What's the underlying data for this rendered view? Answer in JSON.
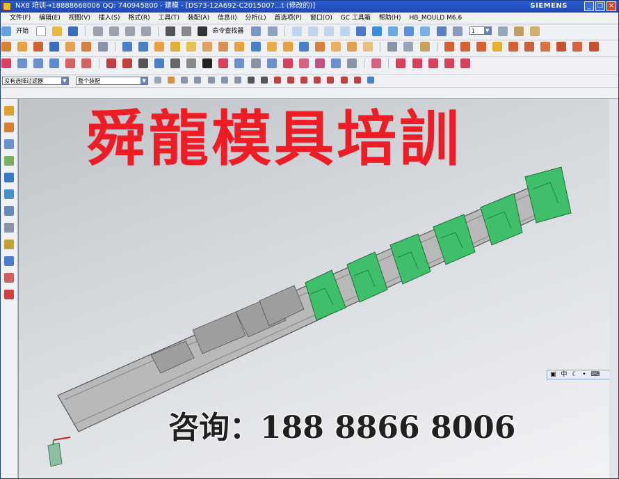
{
  "window": {
    "title": "NX8 培训→18888668006 QQ: 740945800 - 建模 - [DS73-12A692-C2015007...t (修改的)]",
    "brand": "SIEMENS",
    "minimize": "_",
    "restore": "❐",
    "close": "✕"
  },
  "menu": [
    "文件(F)",
    "编辑(E)",
    "视图(V)",
    "插入(S)",
    "格式(R)",
    "工具(T)",
    "装配(A)",
    "信息(I)",
    "分析(L)",
    "首选项(P)",
    "窗口(O)",
    "GC 工具箱",
    "帮助(H)",
    "HB_MOULD M6.6"
  ],
  "toolbar1": {
    "start_label": "开始",
    "command_finder_label": "命令查找器",
    "layer_value": "1"
  },
  "filterbar": {
    "selection_filter": "没有选择过滤器",
    "scope": "整个装配"
  },
  "banner": {
    "text": "舜龍模具培訓"
  },
  "contact": {
    "text": "咨询：188 8866 8006"
  },
  "ime": {
    "label": "中"
  },
  "colors": {
    "banner": "#ee1c24",
    "part_grey": "#b8b8b8",
    "part_green": "#3fbf6a",
    "titlebar": "#1e46b8"
  }
}
